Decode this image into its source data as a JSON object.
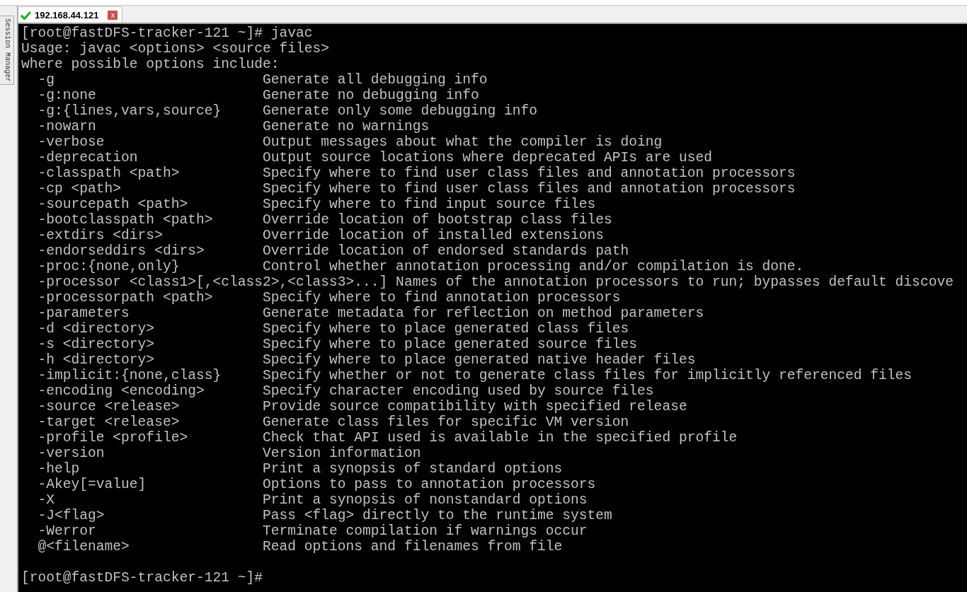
{
  "sidebar": {
    "tab": "Session Manager"
  },
  "tabs": [
    {
      "label": "192.168.44.121",
      "selected": true,
      "close": "x"
    }
  ],
  "terminal": {
    "lines": [
      "[root@fastDFS-tracker-121 ~]# javac",
      "Usage: javac <options> <source files>",
      "where possible options include:",
      "  -g                         Generate all debugging info",
      "  -g:none                    Generate no debugging info",
      "  -g:{lines,vars,source}     Generate only some debugging info",
      "  -nowarn                    Generate no warnings",
      "  -verbose                   Output messages about what the compiler is doing",
      "  -deprecation               Output source locations where deprecated APIs are used",
      "  -classpath <path>          Specify where to find user class files and annotation processors",
      "  -cp <path>                 Specify where to find user class files and annotation processors",
      "  -sourcepath <path>         Specify where to find input source files",
      "  -bootclasspath <path>      Override location of bootstrap class files",
      "  -extdirs <dirs>            Override location of installed extensions",
      "  -endorseddirs <dirs>       Override location of endorsed standards path",
      "  -proc:{none,only}          Control whether annotation processing and/or compilation is done.",
      "  -processor <class1>[,<class2>,<class3>...] Names of the annotation processors to run; bypasses default discove",
      "  -processorpath <path>      Specify where to find annotation processors",
      "  -parameters                Generate metadata for reflection on method parameters",
      "  -d <directory>             Specify where to place generated class files",
      "  -s <directory>             Specify where to place generated source files",
      "  -h <directory>             Specify where to place generated native header files",
      "  -implicit:{none,class}     Specify whether or not to generate class files for implicitly referenced files",
      "  -encoding <encoding>       Specify character encoding used by source files",
      "  -source <release>          Provide source compatibility with specified release",
      "  -target <release>          Generate class files for specific VM version",
      "  -profile <profile>         Check that API used is available in the specified profile",
      "  -version                   Version information",
      "  -help                      Print a synopsis of standard options",
      "  -Akey[=value]              Options to pass to annotation processors",
      "  -X                         Print a synopsis of nonstandard options",
      "  -J<flag>                   Pass <flag> directly to the runtime system",
      "  -Werror                    Terminate compilation if warnings occur",
      "  @<filename>                Read options and filenames from file"
    ],
    "final_prompt": "[root@fastDFS-tracker-121 ~]#"
  }
}
